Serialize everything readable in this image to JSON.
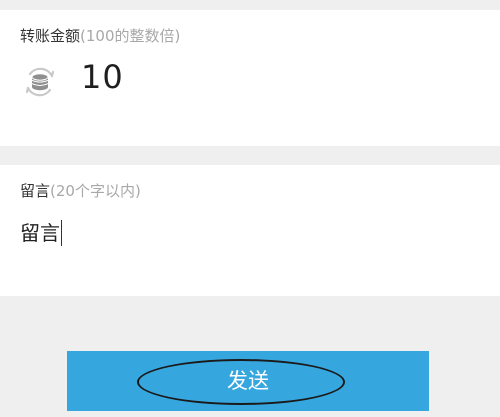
{
  "amount_section": {
    "label": "转账金额",
    "hint": "(100的整数倍)",
    "icon": "coin-stack-icon",
    "value": "10"
  },
  "message_section": {
    "label": "留言",
    "hint": "(20个字以内)",
    "value": "留言"
  },
  "send_button": {
    "label": "发送",
    "color": "#36a6de"
  },
  "colors": {
    "background": "#efefef",
    "card": "#ffffff",
    "hint_text": "#a8a8a8"
  }
}
